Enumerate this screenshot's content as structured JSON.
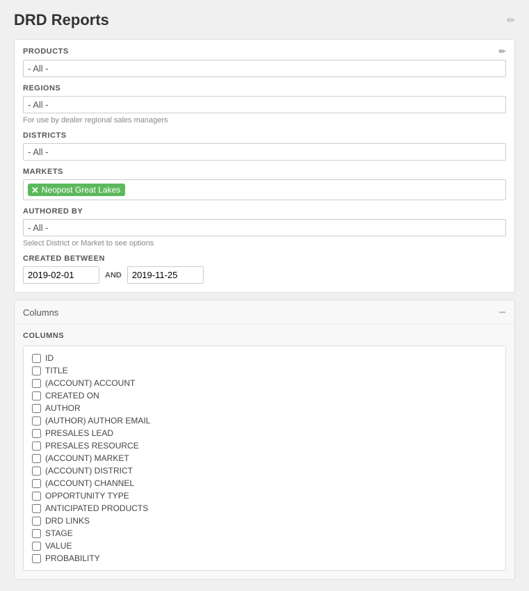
{
  "page": {
    "title": "DRD Reports"
  },
  "filters": {
    "products_label": "PRODUCTS",
    "products_value": "- All -",
    "regions_label": "REGIONS",
    "regions_value": "- All -",
    "regions_hint": "For use by dealer regional sales managers",
    "districts_label": "DISTRICTS",
    "districts_value": "- All -",
    "markets_label": "MARKETS",
    "markets_tag": "Neopost Great Lakes",
    "authored_by_label": "AUTHORED BY",
    "authored_by_value": "- All -",
    "authored_by_hint": "Select District or Market to see options",
    "created_between_label": "CREATED BETWEEN",
    "date_from": "2019-02-01",
    "date_and": "AND",
    "date_to": "2019-11-25"
  },
  "columns_section": {
    "header": "Columns",
    "inner_header": "COLUMNS",
    "items": [
      {
        "label": "ID",
        "checked": false
      },
      {
        "label": "TITLE",
        "checked": false
      },
      {
        "label": "(ACCOUNT) ACCOUNT",
        "checked": false
      },
      {
        "label": "CREATED ON",
        "checked": false
      },
      {
        "label": "AUTHOR",
        "checked": false
      },
      {
        "label": "(AUTHOR) AUTHOR EMAIL",
        "checked": false
      },
      {
        "label": "PRESALES LEAD",
        "checked": false
      },
      {
        "label": "PRESALES RESOURCE",
        "checked": false
      },
      {
        "label": "(ACCOUNT) MARKET",
        "checked": false
      },
      {
        "label": "(ACCOUNT) DISTRICT",
        "checked": false
      },
      {
        "label": "(ACCOUNT) CHANNEL",
        "checked": false
      },
      {
        "label": "OPPORTUNITY TYPE",
        "checked": false
      },
      {
        "label": "ANTICIPATED PRODUCTS",
        "checked": false
      },
      {
        "label": "DRD LINKS",
        "checked": false
      },
      {
        "label": "STAGE",
        "checked": false
      },
      {
        "label": "VALUE",
        "checked": false
      },
      {
        "label": "PROBABILITY",
        "checked": false
      }
    ]
  }
}
